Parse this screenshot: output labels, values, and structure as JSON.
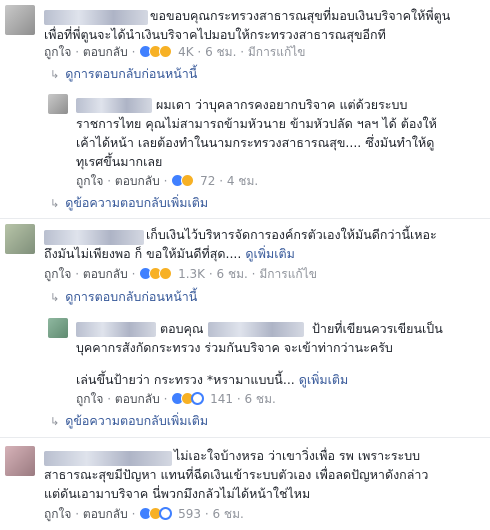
{
  "labels": {
    "like": "ถูกใจ",
    "reply": "ตอบกลับ",
    "edited": "มีการแก้ไข",
    "sep": "·"
  },
  "comment1": {
    "line1": "ขอขอบคุณกระทรวงสาธารณสุขที่มอบเงินบริจาคให้พี่ตูน",
    "line2": "เพื่อที่พี่ตูนจะได้นำเงินบริจาคไปมอบให้กระทรวงสาธารณสุขอีกที",
    "count": "4K",
    "time": "6 ชม.",
    "prev_replies": "ดูการตอบกลับก่อนหน้านี้"
  },
  "reply1": {
    "line1": "ผมเดา ว่าบุคลากรคงอยากบริจาค แต่ด้วยระบบ",
    "line2": "ราชการไทย คุณไม่สามารถข้ามหัวนาย ข้ามหัวปลัด ฯลฯ ได้ ต้องให้",
    "line3": "เค้าได้หน้า เลยต้องทำในนามกระทรวงสาธารณสุข.... ซึ่งมันทำให้ดู",
    "line4": "ทุเรศขึ้นมากเลย",
    "count": "72",
    "time": "4 ชม.",
    "more_replies": "ดูข้อความตอบกลับเพิ่มเติม"
  },
  "comment2": {
    "line1": "เก็บเงินไว้บริหารจัดการองค์กรตัวเองให้มันดีกว่านี้เหอะ",
    "line2": "ถึงมันไม่เพียงพอ ก็ ขอให้มันดีที่สุด....",
    "see_more": "ดูเพิ่มเติม",
    "count": "1.3K",
    "time": "6 ชม.",
    "prev_replies": "ดูการตอบกลับก่อนหน้านี้"
  },
  "reply2": {
    "prefix": "ตอบคุณ",
    "line1_suffix": "ป้ายที่เขียนควรเขียนเป็น",
    "line2": "บุคคากรสังกัดกระทรวง ร่วมกันบริจาค จะเข้าท่ากว่านะครับ",
    "line3": "เล่นขึ้นป้ายว่า กระทรวง *หรามาแบบนี้...",
    "see_more": "ดูเพิ่มเติม",
    "count": "141",
    "time": "6 ชม.",
    "more_replies": "ดูข้อความตอบกลับเพิ่มเติม"
  },
  "comment3": {
    "line1": "ไม่เอะใจบ้างหรอ ว่าเขาวิ่งเพื่อ รพ เพราะระบบ",
    "line2": "สาธารณะสุขมีปัญหา แทนที่ฉีดเงินเข้าระบบตัวเอง เพื่อลดปัญหาดังกล่าว",
    "line3": "แต่ดันเอามาบริจาค นี่พวกมึงกลัวไม่ได้หน้าใช่ไหม",
    "count": "593",
    "time": "6 ชม."
  }
}
